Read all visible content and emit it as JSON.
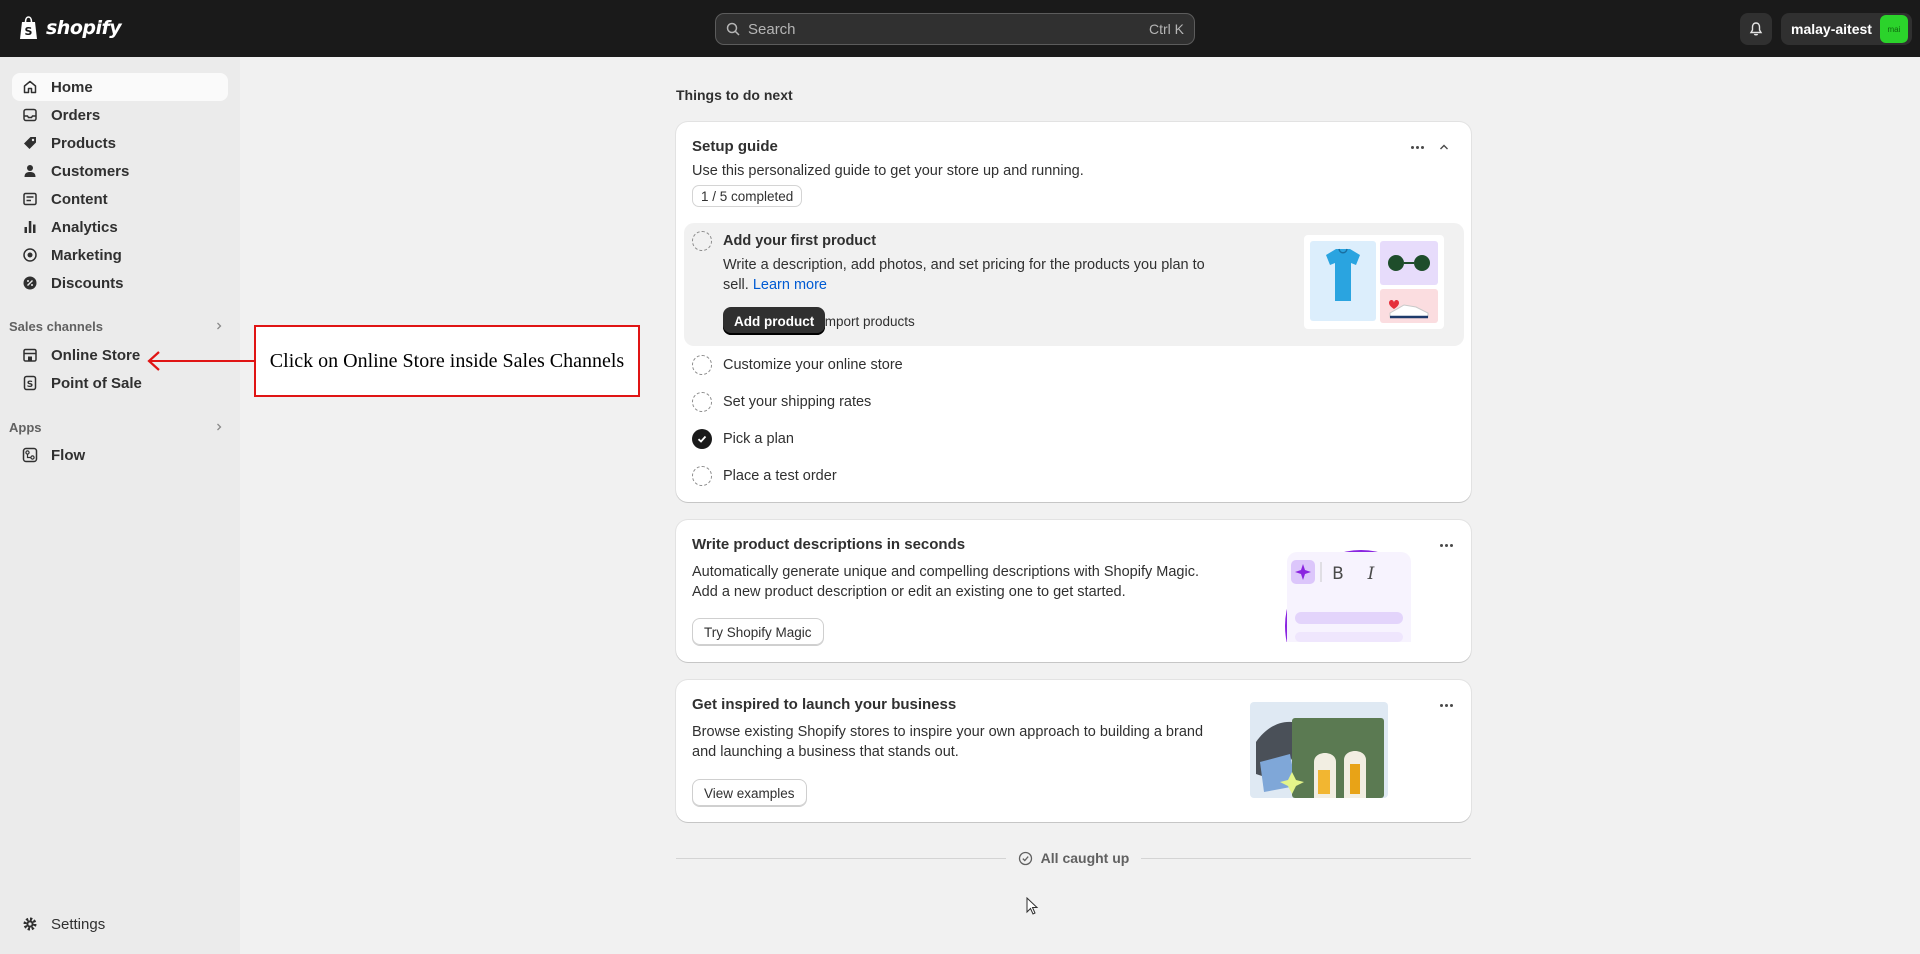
{
  "topbar": {
    "logo_text": "shopify",
    "search_placeholder": "Search",
    "search_shortcut": "Ctrl K",
    "store_name": "malay-aitest",
    "avatar_initials": "mai"
  },
  "sidebar": {
    "items": [
      {
        "label": "Home",
        "icon": "home-icon"
      },
      {
        "label": "Orders",
        "icon": "inbox-icon"
      },
      {
        "label": "Products",
        "icon": "tag-icon"
      },
      {
        "label": "Customers",
        "icon": "person-icon"
      },
      {
        "label": "Content",
        "icon": "image-icon"
      },
      {
        "label": "Analytics",
        "icon": "bar-chart-icon"
      },
      {
        "label": "Marketing",
        "icon": "target-icon"
      },
      {
        "label": "Discounts",
        "icon": "discount-icon"
      }
    ],
    "sales_channels_label": "Sales channels",
    "sales_channels": [
      {
        "label": "Online Store",
        "icon": "store-icon"
      },
      {
        "label": "Point of Sale",
        "icon": "pos-icon"
      }
    ],
    "apps_label": "Apps",
    "apps": [
      {
        "label": "Flow",
        "icon": "flow-icon"
      }
    ],
    "settings_label": "Settings"
  },
  "annotation": {
    "text": "Click on Online Store inside Sales Channels",
    "color": "#e01414"
  },
  "main": {
    "heading": "Things to do next",
    "setup_guide": {
      "title": "Setup guide",
      "description": "Use this personalized guide to get your store up and running.",
      "progress": "1 / 5 completed",
      "progress_fraction": 0.2,
      "active_step": {
        "title": "Add your first product",
        "description_line1": "Write a description, add photos, and set pricing for the products you plan to",
        "description_line2": "sell.",
        "learn_more": "Learn more",
        "primary_button": "Add product",
        "secondary_button": "Import products"
      },
      "steps": [
        {
          "label": "Customize your online store",
          "done": false
        },
        {
          "label": "Set your shipping rates",
          "done": false
        },
        {
          "label": "Pick a plan",
          "done": true
        },
        {
          "label": "Place a test order",
          "done": false
        }
      ]
    },
    "magic_card": {
      "title": "Write product descriptions in seconds",
      "description_line1": "Automatically generate unique and compelling descriptions with Shopify Magic.",
      "description_line2": "Add a new product description or edit an existing one to get started.",
      "button": "Try Shopify Magic",
      "editor_bold": "B",
      "editor_italic": "I"
    },
    "inspire_card": {
      "title": "Get inspired to launch your business",
      "description_line1": "Browse existing Shopify stores to inspire your own approach to building a brand",
      "description_line2": "and launching a business that stands out.",
      "button": "View examples"
    },
    "caught_up": "All caught up"
  }
}
